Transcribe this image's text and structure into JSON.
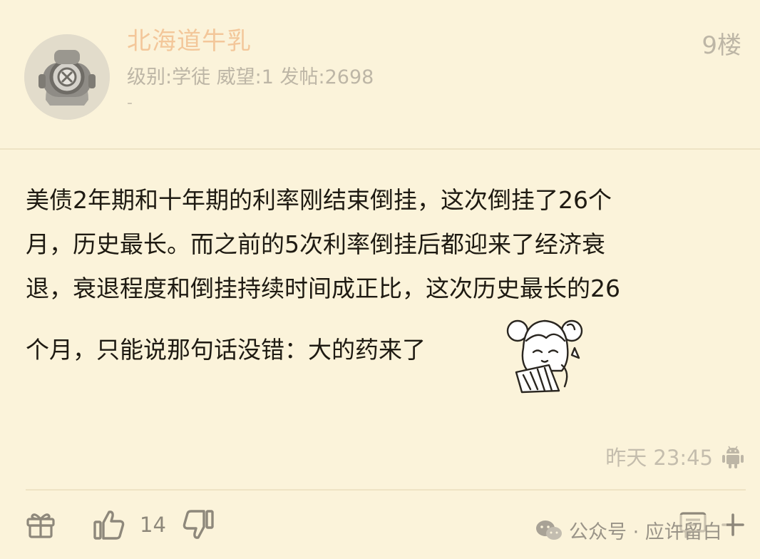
{
  "post": {
    "username": "北海道牛乳",
    "meta": "级别:学徒 威望:1 发帖:2698",
    "signature": "-",
    "floor": "9楼",
    "content_lines": [
      "美债2年期和十年期的利率刚结束倒挂，这次倒挂了26个",
      "月，历史最长。而之前的5次利率倒挂后都迎来了经济衰",
      "退，衰退程度和倒挂持续时间成正比，这次历史最长的26",
      "个月，只能说那句话没错：大的药来了"
    ],
    "timestamp": "昨天 23:45",
    "like_count": "14"
  },
  "icons": {
    "avatar": "diving-helmet-avatar",
    "sticker": "anime-girl-fan-sticker",
    "device": "android-icon",
    "gift": "gift-icon",
    "like": "thumbs-up-icon",
    "dislike": "thumbs-down-icon",
    "comment": "comment-icon",
    "more": "plus-icon",
    "watermark": "wechat-icon"
  },
  "watermark": {
    "text": "公众号 · 应许留白"
  },
  "colors": {
    "background": "#fbf3da",
    "username": "#f3c79a",
    "meta": "#bdb6a6",
    "text": "#1e1a12"
  }
}
